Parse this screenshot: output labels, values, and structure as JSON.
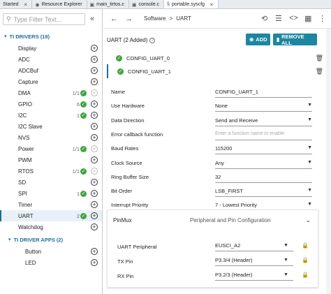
{
  "tabs": [
    {
      "label": "Started"
    },
    {
      "label": "Resource Explorer"
    },
    {
      "label": "main_tirtos.c"
    },
    {
      "label": "console.c"
    },
    {
      "label": "portable.syscfg"
    }
  ],
  "filter": {
    "placeholder": "Type Filter Text..."
  },
  "tree": {
    "driver_group": "TI DRIVERS (18)",
    "items": [
      {
        "label": "Display",
        "count": "",
        "ok": false,
        "dis": false
      },
      {
        "label": "ADC",
        "count": "",
        "ok": false,
        "dis": false
      },
      {
        "label": "ADCBuf",
        "count": "",
        "ok": false,
        "dis": false
      },
      {
        "label": "Capture",
        "count": "",
        "ok": false,
        "dis": false
      },
      {
        "label": "DMA",
        "count": "1/1",
        "ok": true,
        "dis": true
      },
      {
        "label": "GPIO",
        "count": "6",
        "ok": true,
        "dis": false
      },
      {
        "label": "I2C",
        "count": "1",
        "ok": true,
        "dis": false
      },
      {
        "label": "I2C Slave",
        "count": "",
        "ok": false,
        "dis": false
      },
      {
        "label": "NVS",
        "count": "",
        "ok": false,
        "dis": false
      },
      {
        "label": "Power",
        "count": "1/1",
        "ok": true,
        "dis": true
      },
      {
        "label": "PWM",
        "count": "",
        "ok": false,
        "dis": false
      },
      {
        "label": "RTOS",
        "count": "1/1",
        "ok": true,
        "dis": true
      },
      {
        "label": "SD",
        "count": "",
        "ok": false,
        "dis": false
      },
      {
        "label": "SPI",
        "count": "1",
        "ok": true,
        "dis": false
      },
      {
        "label": "Timer",
        "count": "",
        "ok": false,
        "dis": false
      },
      {
        "label": "UART",
        "count": "2",
        "ok": true,
        "dis": false
      },
      {
        "label": "Watchdog",
        "count": "",
        "ok": false,
        "dis": false
      }
    ],
    "app_group": "TI DRIVER APPS (2)",
    "apps": [
      {
        "label": "Button"
      },
      {
        "label": "LED"
      }
    ]
  },
  "breadcrumb": {
    "root": "Software",
    "sep": ">",
    "leaf": "UART"
  },
  "config": {
    "title": "UART (2 Added)",
    "add_label": "ADD",
    "remove_label": "REMOVE ALL",
    "instances": [
      {
        "name": "CONFIG_UART_0"
      },
      {
        "name": "CONFIG_UART_1"
      }
    ]
  },
  "props": [
    {
      "label": "Name",
      "value": "CONFIG_UART_1",
      "type": "text"
    },
    {
      "label": "Use Hardware",
      "value": "None",
      "type": "select"
    },
    {
      "label": "Data Direction",
      "value": "Send and Receive",
      "type": "select"
    },
    {
      "label": "Error callback function",
      "value": "Enter a function name to enable",
      "type": "placeholder"
    },
    {
      "label": "Baud Rates",
      "value": "115200",
      "type": "select"
    },
    {
      "label": "Clock Source",
      "value": "Any",
      "type": "select"
    },
    {
      "label": "Ring Buffer Size",
      "value": "32",
      "type": "text"
    },
    {
      "label": "Bit Order",
      "value": "LSB_FIRST",
      "type": "select"
    },
    {
      "label": "Interrupt Priority",
      "value": "7 - Lowest Priority",
      "type": "select"
    }
  ],
  "pinmux": {
    "title": "PinMux",
    "subtitle": "Peripheral and Pin Configuration",
    "rows": [
      {
        "label": "UART Peripheral",
        "value": "EUSCI_A2"
      },
      {
        "label": "TX Pin",
        "value": "P3.3/4 (Header)"
      },
      {
        "label": "RX Pin",
        "value": "P3.2/3 (Header)"
      }
    ]
  },
  "colors": {
    "accent": "#1d86a0",
    "ok": "#3fa53f",
    "group": "#1a6e9e"
  }
}
